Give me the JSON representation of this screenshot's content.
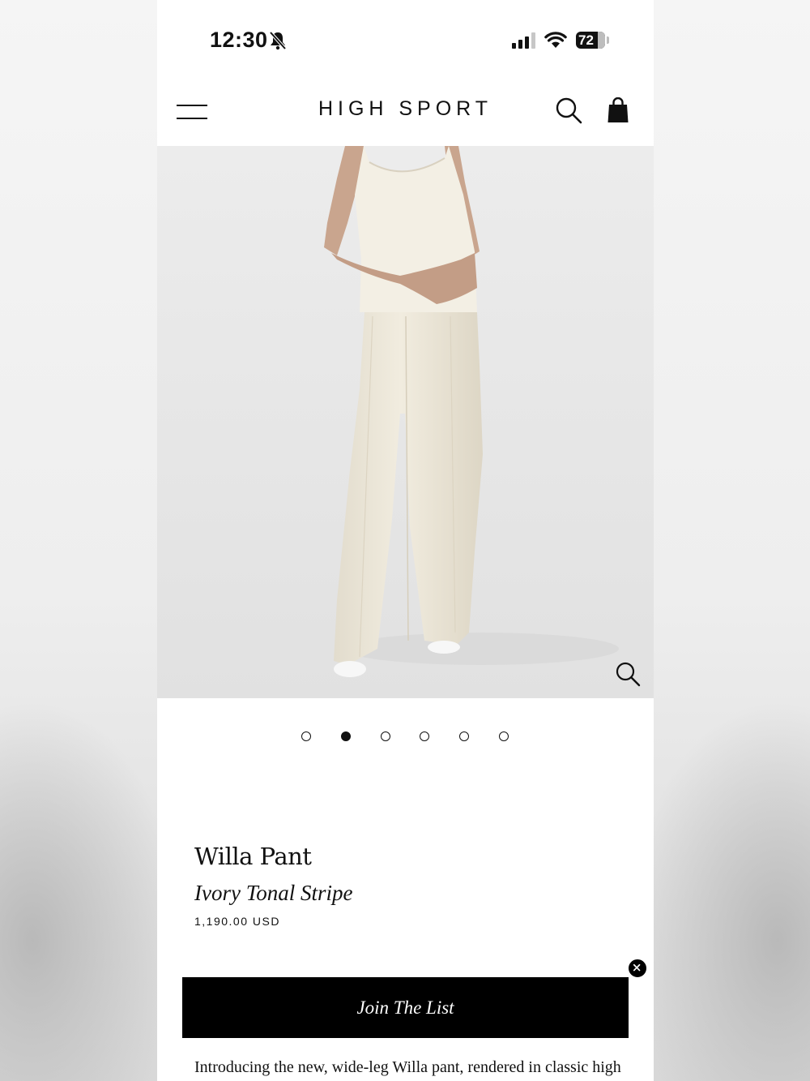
{
  "status_bar": {
    "time": "12:30",
    "battery": "72",
    "icons": [
      "bell-slash-icon",
      "cellular-signal-icon",
      "wifi-icon",
      "battery-icon"
    ]
  },
  "header": {
    "brand": "HIGH SPORT",
    "icons": [
      "hamburger-menu-icon",
      "search-icon",
      "shopping-bag-icon"
    ]
  },
  "gallery": {
    "image_alt": "Model wearing ivory sleeveless top and wide-leg pants",
    "slide_count": 6,
    "active_slide": 2,
    "zoom_icon": "zoom-icon"
  },
  "product": {
    "name": "Willa Pant",
    "color": "Ivory Tonal Stripe",
    "price": "1,190.00 USD",
    "description": "Introducing the new, wide-leg Willa pant, rendered in classic high"
  },
  "join_banner": {
    "label": "Join The List",
    "close_icon": "close-icon"
  },
  "colors": {
    "accent": "#000000",
    "page_bg": "#ffffff",
    "garment": "#efeadd"
  }
}
